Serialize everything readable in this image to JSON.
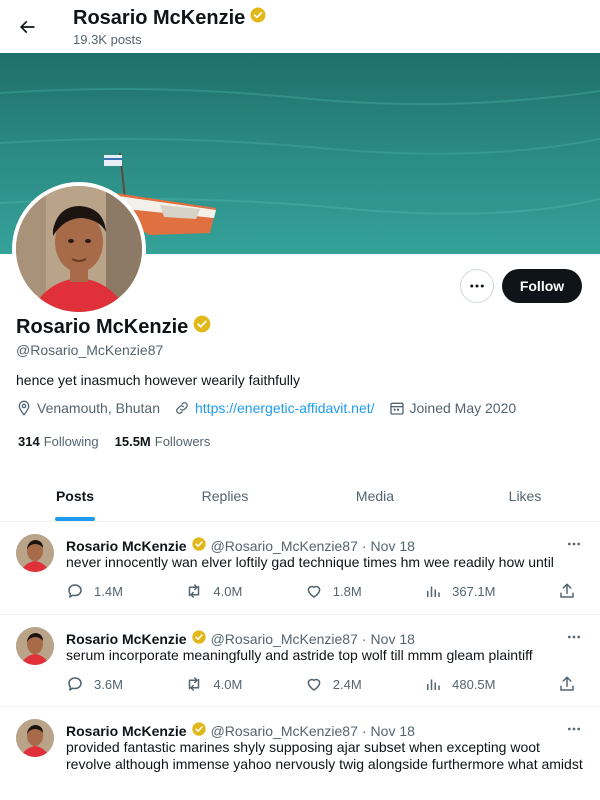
{
  "header": {
    "title": "Rosario McKenzie",
    "post_count": "19.3K posts"
  },
  "profile": {
    "name": "Rosario McKenzie",
    "handle": "@Rosario_McKenzie87",
    "bio": "hence yet inasmuch however wearily faithfully",
    "location": "Venamouth, Bhutan",
    "website": "https://energetic-affidavit.net/",
    "joined": "Joined May 2020",
    "following_count": "314",
    "following_label": "Following",
    "followers_count": "15.5M",
    "followers_label": "Followers",
    "follow_label": "Follow"
  },
  "tabs": [
    {
      "label": "Posts",
      "active": true
    },
    {
      "label": "Replies",
      "active": false
    },
    {
      "label": "Media",
      "active": false
    },
    {
      "label": "Likes",
      "active": false
    }
  ],
  "tweets": [
    {
      "name": "Rosario McKenzie",
      "handle": "@Rosario_McKenzie87",
      "date": "Nov 18",
      "text": "never innocently wan elver loftily gad technique times hm wee readily how until",
      "replies": "1.4M",
      "reposts": "4.0M",
      "likes": "1.8M",
      "views": "367.1M"
    },
    {
      "name": "Rosario McKenzie",
      "handle": "@Rosario_McKenzie87",
      "date": "Nov 18",
      "text": "serum incorporate meaningfully and astride top wolf till mmm gleam plaintiff",
      "replies": "3.6M",
      "reposts": "4.0M",
      "likes": "2.4M",
      "views": "480.5M"
    },
    {
      "name": "Rosario McKenzie",
      "handle": "@Rosario_McKenzie87",
      "date": "Nov 18",
      "text": "provided fantastic marines shyly supposing ajar subset when excepting woot revolve although immense yahoo nervously twig alongside furthermore what amidst"
    }
  ],
  "colors": {
    "accent": "#1d9bf0",
    "verified": "#e2b719",
    "text_secondary": "#536471",
    "button_dark": "#0f1419"
  },
  "icons": {
    "back": "arrow-left-icon",
    "verified": "verified-badge-icon",
    "more": "more-horizontal-icon",
    "location": "location-pin-icon",
    "link": "link-icon",
    "calendar": "calendar-icon",
    "reply": "reply-icon",
    "repost": "repost-icon",
    "like": "heart-icon",
    "views": "analytics-icon",
    "share": "share-icon"
  }
}
